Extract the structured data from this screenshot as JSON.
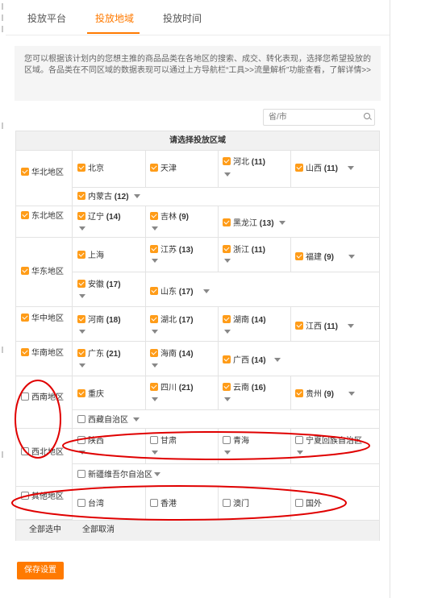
{
  "tabs": [
    {
      "label": "投放平台",
      "active": false
    },
    {
      "label": "投放地域",
      "active": true
    },
    {
      "label": "投放时间",
      "active": false
    }
  ],
  "info": {
    "text": "您可以根据该计划内的您想主推的商品品类在各地区的搜索、成交、转化表现，选择您希望投放的区域。各品类在不同区域的数据表现可以通过上方导航栏“工具>>流量解析”功能查看，了解详情>>"
  },
  "search": {
    "placeholder": "省/市",
    "value": ""
  },
  "grid": {
    "title": "请选择投放区域"
  },
  "regions": {
    "huabei": {
      "label": "华北地区",
      "checked": true
    },
    "dongbei": {
      "label": "东北地区",
      "checked": true
    },
    "huadong": {
      "label": "华东地区",
      "checked": true
    },
    "huazhong": {
      "label": "华中地区",
      "checked": true
    },
    "huanan": {
      "label": "华南地区",
      "checked": true
    },
    "xinan": {
      "label": "西南地区",
      "checked": false
    },
    "xibei": {
      "label": "西北地区",
      "checked": false
    },
    "qita": {
      "label": "其他地区",
      "checked": false
    }
  },
  "provinces": {
    "beijing": {
      "name": "北京",
      "count": "",
      "checked": true
    },
    "tianjin": {
      "name": "天津",
      "count": "",
      "checked": true
    },
    "hebei": {
      "name": "河北",
      "count": "(11)",
      "checked": true
    },
    "shanxi": {
      "name": "山西",
      "count": "(11)",
      "checked": true
    },
    "neimenggu": {
      "name": "内蒙古",
      "count": "(12)",
      "checked": true
    },
    "liaoning": {
      "name": "辽宁",
      "count": "(14)",
      "checked": true
    },
    "jilin": {
      "name": "吉林",
      "count": "(9)",
      "checked": true
    },
    "heilongjiang": {
      "name": "黑龙江",
      "count": "(13)",
      "checked": true
    },
    "shanghai": {
      "name": "上海",
      "count": "",
      "checked": true
    },
    "jiangsu": {
      "name": "江苏",
      "count": "(13)",
      "checked": true
    },
    "zhejiang": {
      "name": "浙江",
      "count": "(11)",
      "checked": true
    },
    "fujian": {
      "name": "福建",
      "count": "(9)",
      "checked": true
    },
    "anhui": {
      "name": "安徽",
      "count": "(17)",
      "checked": true
    },
    "shandong": {
      "name": "山东",
      "count": "(17)",
      "checked": true
    },
    "henan": {
      "name": "河南",
      "count": "(18)",
      "checked": true
    },
    "hubei": {
      "name": "湖北",
      "count": "(17)",
      "checked": true
    },
    "hunan": {
      "name": "湖南",
      "count": "(14)",
      "checked": true
    },
    "jiangxi": {
      "name": "江西",
      "count": "(11)",
      "checked": true
    },
    "guangdong": {
      "name": "广东",
      "count": "(21)",
      "checked": true
    },
    "hainan": {
      "name": "海南",
      "count": "(14)",
      "checked": true
    },
    "guangxi": {
      "name": "广西",
      "count": "(14)",
      "checked": true
    },
    "chongqing": {
      "name": "重庆",
      "count": "",
      "checked": true
    },
    "sichuan": {
      "name": "四川",
      "count": "(21)",
      "checked": true
    },
    "yunnan": {
      "name": "云南",
      "count": "(16)",
      "checked": true
    },
    "guizhou": {
      "name": "贵州",
      "count": "(9)",
      "checked": true
    },
    "xizang": {
      "name": "西藏自治区",
      "count": "",
      "checked": false
    },
    "shaanxi": {
      "name": "陕西",
      "count": "",
      "checked": false
    },
    "gansu": {
      "name": "甘肃",
      "count": "",
      "checked": false
    },
    "qinghai": {
      "name": "青海",
      "count": "",
      "checked": false
    },
    "ningxia": {
      "name": "宁夏回族自治区",
      "count": "",
      "checked": false
    },
    "xinjiang": {
      "name": "新疆维吾尔自治区",
      "count": "",
      "checked": false
    },
    "taiwan": {
      "name": "台湾",
      "count": "",
      "checked": false
    },
    "xianggang": {
      "name": "香港",
      "count": "",
      "checked": false
    },
    "aomen": {
      "name": "澳门",
      "count": "",
      "checked": false
    },
    "guowai": {
      "name": "国外",
      "count": "",
      "checked": false
    }
  },
  "footer": {
    "select_all": "全部选中",
    "deselect_all": "全部取消"
  },
  "save_label": "保存设置",
  "colors": {
    "accent": "#ff7a00",
    "checkbox_on": "#ff9c18",
    "annotation": "#e00000"
  }
}
